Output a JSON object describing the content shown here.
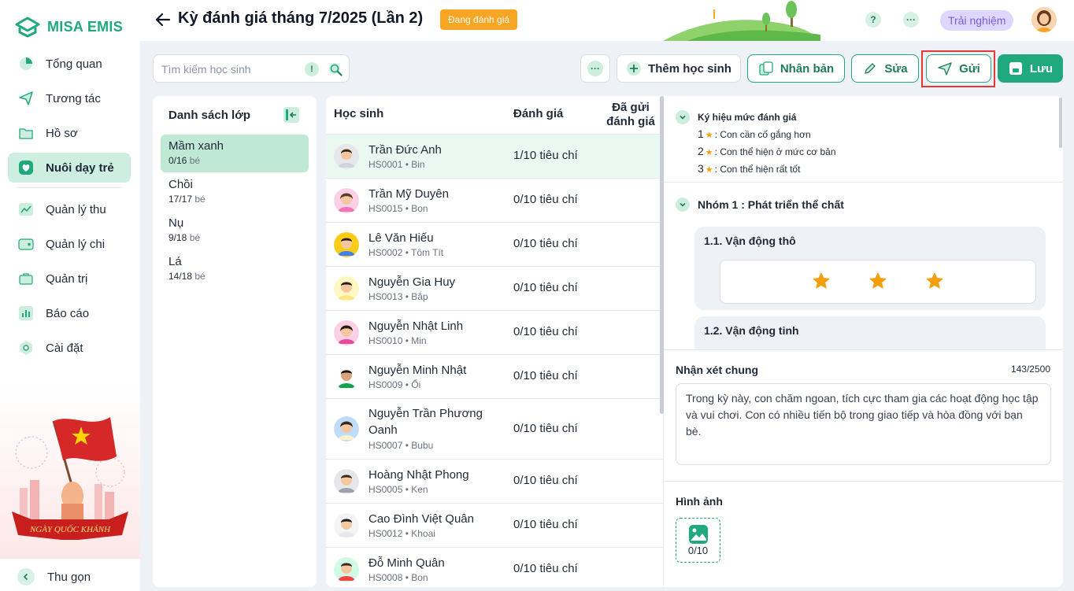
{
  "app": {
    "name": "MISA EMIS"
  },
  "sidebar": {
    "items": [
      {
        "label": "Tổng quan",
        "icon": "pie-chart-icon"
      },
      {
        "label": "Tương tác",
        "icon": "paper-plane-icon"
      },
      {
        "label": "Hồ sơ",
        "icon": "folder-icon"
      },
      {
        "label": "Nuôi dạy trẻ",
        "icon": "heart-icon",
        "active": true
      },
      {
        "label": "Quản lý thu",
        "icon": "trend-icon"
      },
      {
        "label": "Quản lý chi",
        "icon": "wallet-icon"
      },
      {
        "label": "Quản trị",
        "icon": "briefcase-icon"
      },
      {
        "label": "Báo cáo",
        "icon": "bar-chart-icon"
      },
      {
        "label": "Cài đặt",
        "icon": "gear-icon"
      }
    ],
    "promo_text": "NGÀY QUỐC KHÁNH",
    "collapse_label": "Thu gọn"
  },
  "header": {
    "title": "Kỳ đánh giá tháng 7/2025 (Lần 2)",
    "status": "Đang đánh giá",
    "help": "?",
    "more": "···",
    "trial": "Trải nghiệm"
  },
  "toolbar": {
    "search_placeholder": "Tìm kiếm học sinh",
    "info": "!",
    "more": "···",
    "add_student": "Thêm học sinh",
    "duplicate": "Nhân bản",
    "edit": "Sửa",
    "send": "Gửi",
    "save": "Lưu"
  },
  "classes": {
    "title": "Danh sách lớp",
    "unit": "bé",
    "items": [
      {
        "name": "Mầm xanh",
        "count": "0/16",
        "active": true
      },
      {
        "name": "Chồi",
        "count": "17/17"
      },
      {
        "name": "Nụ",
        "count": "9/18"
      },
      {
        "name": "Lá",
        "count": "14/18"
      }
    ]
  },
  "students": {
    "columns": {
      "name": "Học sinh",
      "eval": "Đánh giá",
      "sent": "Đã gửi đánh giá"
    },
    "rows": [
      {
        "name": "Trần Đức Anh",
        "code": "HS0001 • Bin",
        "eval": "1/10 tiêu chí"
      },
      {
        "name": "Trần Mỹ Duyên",
        "code": "HS0015 • Bon",
        "eval": "0/10 tiêu chí"
      },
      {
        "name": "Lê Văn Hiếu",
        "code": "HS0002 • Tôm Tít",
        "eval": "0/10 tiêu chí"
      },
      {
        "name": "Nguyễn Gia Huy",
        "code": "HS0013 • Bắp",
        "eval": "0/10 tiêu chí"
      },
      {
        "name": "Nguyễn Nhật Linh",
        "code": "HS0010 • Min",
        "eval": "0/10 tiêu chí"
      },
      {
        "name": "Nguyễn Minh Nhật",
        "code": "HS0009 • Ổi",
        "eval": "0/10 tiêu chí"
      },
      {
        "name": "Nguyễn Trần Phương Oanh",
        "code": "HS0007 • Bubu",
        "eval": "0/10 tiêu chí"
      },
      {
        "name": "Hoàng Nhật Phong",
        "code": "HS0005 • Ken",
        "eval": "0/10 tiêu chí"
      },
      {
        "name": "Cao Đình Việt Quân",
        "code": "HS0012 • Khoai",
        "eval": "0/10 tiêu chí"
      },
      {
        "name": "Đỗ Minh Quân",
        "code": "HS0008 • Bon",
        "eval": "0/10 tiêu chí"
      }
    ]
  },
  "detail": {
    "legend_title": "Ký hiệu mức đánh giá",
    "legend": [
      {
        "num": "1",
        "text": ": Con cần cố gắng hơn"
      },
      {
        "num": "2",
        "text": ": Con thể hiện ở mức cơ bản"
      },
      {
        "num": "3",
        "text": ": Con thể hiện rất tốt"
      }
    ],
    "group_title": "Nhóm 1 : Phát triển thể chất",
    "criteria": [
      {
        "title": "1.1. Vận động thô",
        "max_stars": 3
      },
      {
        "title": "1.2. Vận động tinh"
      }
    ],
    "remark_label": "Nhận xét chung",
    "remark_count": "143/2500",
    "remark_text": "Trong kỳ này, con chăm ngoan, tích cực tham gia các hoạt động học tập và vui chơi. Con có nhiều tiến bộ trong giao tiếp và hòa đồng với bạn bè.",
    "images_label": "Hình ảnh",
    "images_count": "0/10"
  },
  "colors": {
    "accent": "#1fa97d",
    "badge": "#f6a623",
    "highlight": "#e53935"
  }
}
